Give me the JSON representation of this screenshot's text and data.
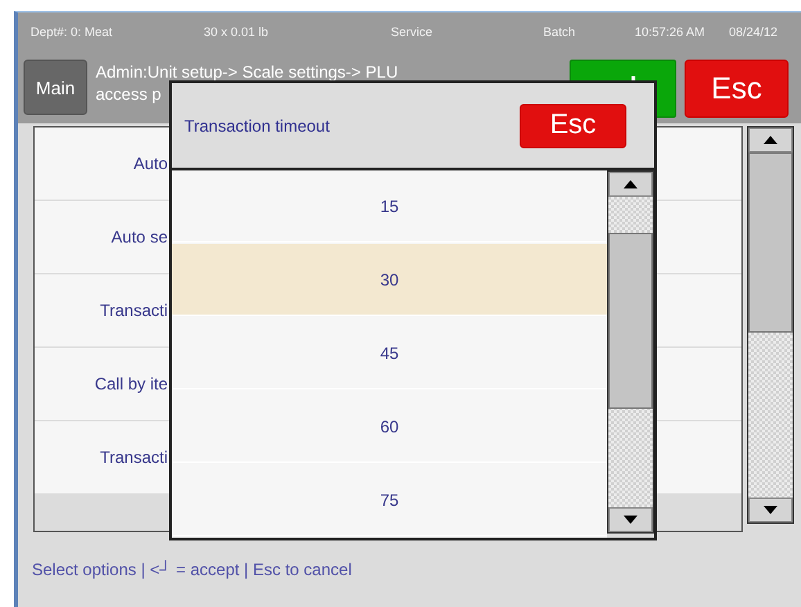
{
  "status_bar": {
    "department": "Dept#: 0: Meat",
    "quantity": "30 x 0.01 lb",
    "mode": "Service",
    "batch": "Batch",
    "time": "10:57:26 AM",
    "date": "08/24/12"
  },
  "header": {
    "main_button": "Main",
    "breadcrumb_lines": [
      "Admin:Unit setup-> Scale settings-> PLU",
      "access p"
    ],
    "esc_button": "Esc"
  },
  "settings_rows": [
    {
      "label": "Auto"
    },
    {
      "label": "Auto se"
    },
    {
      "label": "Transacti"
    },
    {
      "label": "Call by ite"
    },
    {
      "label": "Transacti"
    }
  ],
  "dialog": {
    "title": "Transaction timeout",
    "esc_button": "Esc",
    "options": [
      {
        "label": "15",
        "selected": false
      },
      {
        "label": "30",
        "selected": true
      },
      {
        "label": "45",
        "selected": false
      },
      {
        "label": "60",
        "selected": false
      },
      {
        "label": "75",
        "selected": false
      }
    ]
  },
  "footer": {
    "hint": "Select options | <┘ = accept | Esc to cancel"
  }
}
